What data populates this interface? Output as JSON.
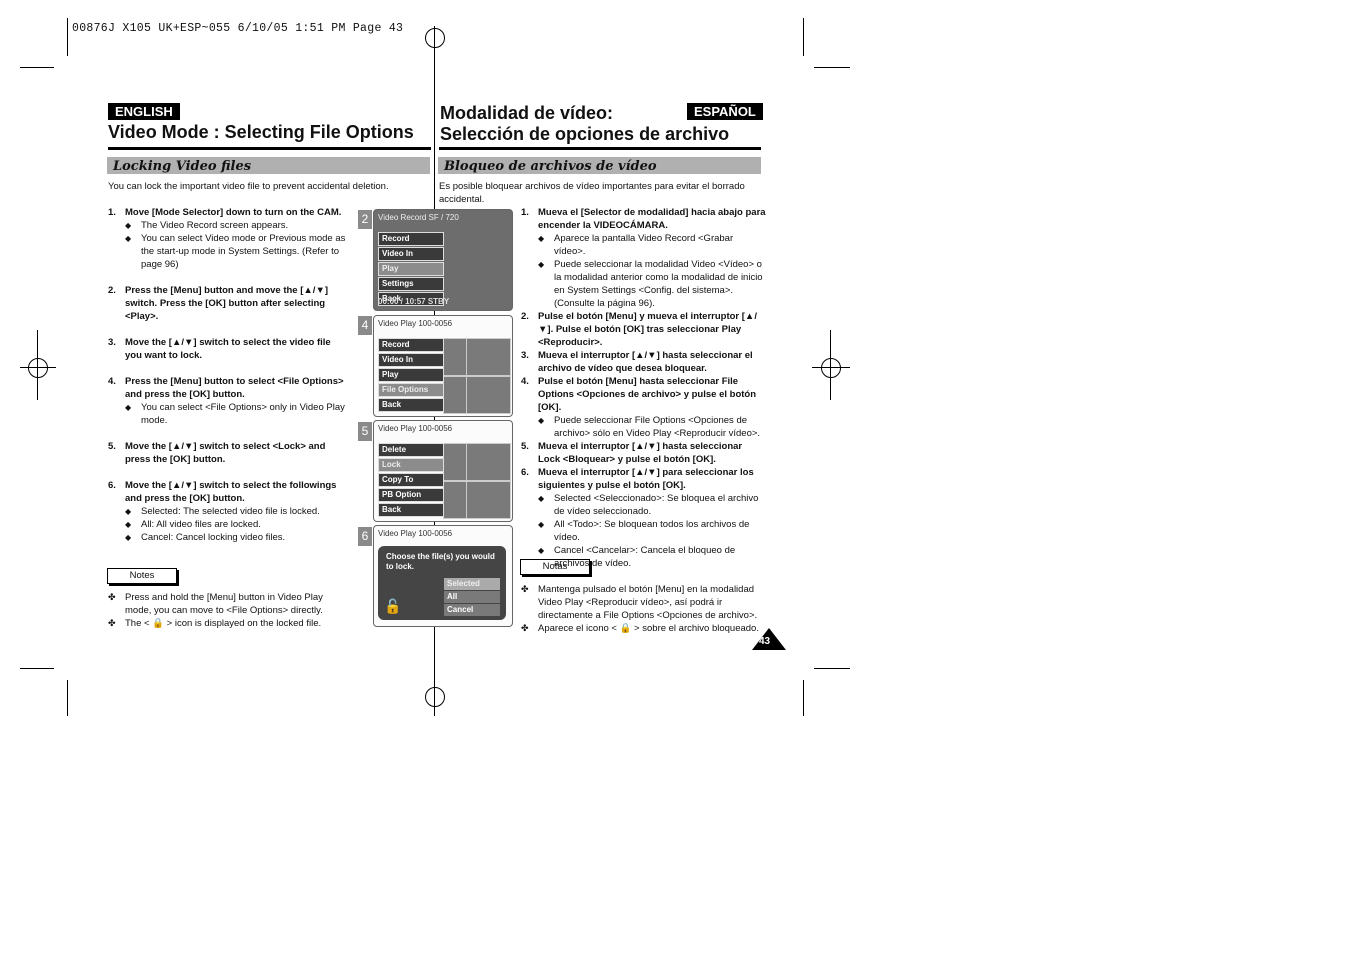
{
  "slug": "00876J X105 UK+ESP~055  6/10/05 1:51 PM  Page 43",
  "english": {
    "lang_tag": "ENGLISH",
    "title": "Video Mode : Selecting File Options",
    "section": "Locking Video files",
    "intro": "You can lock the important video file to prevent accidental deletion.",
    "steps": [
      {
        "num": "1.",
        "text": "Move [Mode Selector] down to turn on the CAM.",
        "bullets": [
          "The Video Record screen appears.",
          "You can select Video mode or Previous mode as the start-up mode in System Settings. (Refer to page 96)"
        ]
      },
      {
        "num": "2.",
        "text": "Press the [Menu] button and move the [▲/▼] switch. Press the [OK] button after selecting <Play>.",
        "bullets": []
      },
      {
        "num": "3.",
        "text": "Move the [▲/▼] switch to select the video file you want to lock.",
        "bullets": []
      },
      {
        "num": "4.",
        "text": "Press the [Menu] button to select <File Options> and press the [OK] button.",
        "bullets": [
          "You can select <File Options> only in Video Play mode."
        ]
      },
      {
        "num": "5.",
        "text": "Move the [▲/▼] switch to select <Lock> and press the [OK] button.",
        "bullets": []
      },
      {
        "num": "6.",
        "text": "Move the [▲/▼] switch to select the followings and press the [OK] button.",
        "bullets": [
          "Selected: The selected video file is locked.",
          "All: All video files are locked.",
          "Cancel: Cancel locking video files."
        ]
      }
    ],
    "notes_label": "Notes",
    "notes": [
      "Press and hold the [Menu] button in Video Play mode, you can move to <File Options> directly.",
      "The < 🔒 > icon is displayed on the locked file."
    ]
  },
  "spanish": {
    "lang_tag": "ESPAÑOL",
    "title_line1": "Modalidad de vídeo:",
    "title_line2": "Selección de opciones de archivo",
    "section": "Bloqueo de archivos de vídeo",
    "intro": "Es posible bloquear archivos de vídeo importantes para evitar el borrado accidental.",
    "steps": [
      {
        "num": "1.",
        "text": "Mueva el [Selector de modalidad] hacia abajo para encender la VIDEOCÁMARA.",
        "bullets": [
          "Aparece la pantalla Video Record <Grabar vídeo>.",
          "Puede seleccionar la modalidad Video <Vídeo> o la modalidad anterior como la modalidad de inicio en System Settings <Config. del sistema>. (Consulte la página 96)."
        ]
      },
      {
        "num": "2.",
        "text": "Pulse el botón [Menu] y mueva el interruptor [▲/▼]. Pulse el botón [OK] tras seleccionar Play <Reproducir>.",
        "bullets": []
      },
      {
        "num": "3.",
        "text": "Mueva el interruptor [▲/▼] hasta seleccionar el archivo de vídeo que desea bloquear.",
        "bullets": []
      },
      {
        "num": "4.",
        "text": "Pulse el botón [Menu] hasta seleccionar File Options <Opciones de archivo> y pulse el botón [OK].",
        "bullets": [
          "Puede seleccionar File Options <Opciones de archivo> sólo en Video Play <Reproducir vídeo>."
        ]
      },
      {
        "num": "5.",
        "text": "Mueva el interruptor [▲/▼] hasta seleccionar Lock <Bloquear> y pulse el botón [OK].",
        "bullets": []
      },
      {
        "num": "6.",
        "text": "Mueva el interruptor [▲/▼] para seleccionar los siguientes y pulse el botón [OK].",
        "bullets": [
          "Selected <Seleccionado>: Se bloquea el archivo de vídeo seleccionado.",
          "All <Todo>: Se bloquean todos los archivos de vídeo.",
          "Cancel <Cancelar>: Cancela el bloqueo de archivos de vídeo."
        ]
      }
    ],
    "notes_label": "Notas",
    "notes": [
      "Mantenga pulsado el botón [Menu] en la modalidad Video Play <Reproducir vídeo>, así podrá ir directamente a File Options <Opciones de archivo>.",
      "Aparece el icono < 🔒 > sobre el archivo bloqueado."
    ]
  },
  "screens": [
    {
      "num": "2",
      "header": "Video Record  SF / 720",
      "menu": [
        "Record",
        "Video In",
        "Play",
        "Settings",
        "Back"
      ],
      "selected": 2,
      "footer": "00:00 / 10:57  STBY"
    },
    {
      "num": "4",
      "header": "Video Play   100-0056",
      "menu": [
        "Record",
        "Video In",
        "Play",
        "File Options",
        "Back"
      ],
      "selected": 3
    },
    {
      "num": "5",
      "header": "Video Play   100-0056",
      "menu": [
        "Delete",
        "Lock",
        "Copy To",
        "PB Option",
        "Back"
      ],
      "selected": 1
    },
    {
      "num": "6",
      "header": "Video Play   100-0056",
      "dialog": "Choose the file(s) you would to lock.",
      "options": [
        "Selected",
        "All",
        "Cancel"
      ],
      "selected": 0
    }
  ],
  "page_number": "43"
}
